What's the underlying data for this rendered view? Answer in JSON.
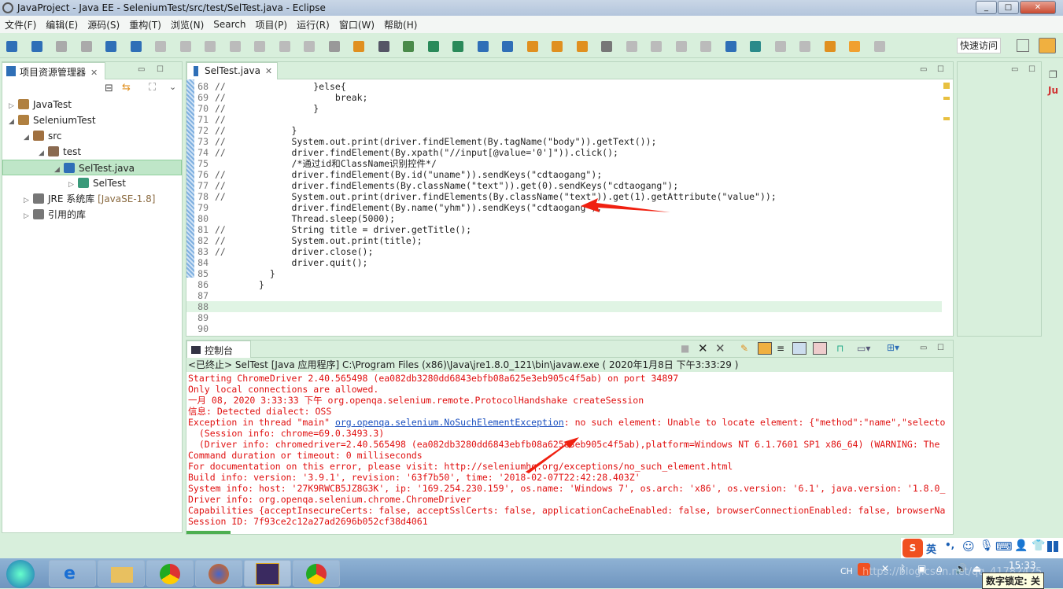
{
  "window": {
    "title": "JavaProject  -  Java EE  -  SeleniumTest/src/test/SelTest.java  -  Eclipse"
  },
  "menu": [
    "文件(F)",
    "编辑(E)",
    "源码(S)",
    "重构(T)",
    "浏览(N)",
    "Search",
    "项目(P)",
    "运行(R)",
    "窗口(W)",
    "帮助(H)"
  ],
  "toolbar": {
    "quick_access": "快速访问"
  },
  "explorer": {
    "title": "项目资源管理器",
    "items": [
      {
        "label": "JavaTest",
        "depth": 0,
        "expanded": false
      },
      {
        "label": "SeleniumTest",
        "depth": 0,
        "expanded": true
      },
      {
        "label": "src",
        "depth": 1,
        "expanded": true
      },
      {
        "label": "test",
        "depth": 2,
        "expanded": true
      },
      {
        "label": "SelTest.java",
        "depth": 3,
        "expanded": true,
        "selected": true
      },
      {
        "label": "SelTest",
        "depth": 4,
        "expanded": false
      },
      {
        "label": "JRE 系统库",
        "extra": "[JavaSE-1.8]",
        "depth": 1,
        "expanded": false
      },
      {
        "label": "引用的库",
        "depth": 1,
        "expanded": false
      }
    ]
  },
  "editor": {
    "tab": "SelTest.java",
    "current_line": 88,
    "lines": [
      {
        "n": "68",
        "c": "//",
        "t": "          }else{"
      },
      {
        "n": "69",
        "c": "//",
        "t": "              break;"
      },
      {
        "n": "70",
        "c": "//",
        "t": "          }"
      },
      {
        "n": "71",
        "c": "//",
        "t": ""
      },
      {
        "n": "72",
        "c": "//",
        "t": "      }"
      },
      {
        "n": "73",
        "c": "//",
        "t": "      System.out.print(driver.findElement(By.tagName(\"body\")).getText());"
      },
      {
        "n": "74",
        "c": "//",
        "t": "      driver.findElement(By.xpath(\"//input[@value='0']\")).click();"
      },
      {
        "n": "75",
        "c": "",
        "t": "      /*通过id和ClassName识别控件*/"
      },
      {
        "n": "76",
        "c": "//",
        "t": "      driver.findElement(By.id(\"uname\")).sendKeys(\"cdtaogang\");"
      },
      {
        "n": "77",
        "c": "//",
        "t": "      driver.findElements(By.className(\"text\")).get(0).sendKeys(\"cdtaogang\");"
      },
      {
        "n": "78",
        "c": "//",
        "t": "      System.out.print(driver.findElements(By.className(\"text\")).get(1).getAttribute(\"value\"));"
      },
      {
        "n": "79",
        "c": "",
        "t": "      driver.findElement(By.name(\"yhm\")).sendKeys(\"cdtaogang\");"
      },
      {
        "n": "80",
        "c": "",
        "t": "      Thread.sleep(5000);"
      },
      {
        "n": "81",
        "c": "//",
        "t": "      String title = driver.getTitle();"
      },
      {
        "n": "82",
        "c": "//",
        "t": "      System.out.print(title);"
      },
      {
        "n": "83",
        "c": "//",
        "t": "      driver.close();"
      },
      {
        "n": "84",
        "c": "",
        "t": "      driver.quit();"
      },
      {
        "n": "85",
        "c": "",
        "t": "  }"
      },
      {
        "n": "86",
        "c": "",
        "t": "}"
      },
      {
        "n": "87",
        "c": "",
        "t": ""
      },
      {
        "n": "88",
        "c": "",
        "t": ""
      },
      {
        "n": "89",
        "c": "",
        "t": ""
      },
      {
        "n": "90",
        "c": "",
        "t": ""
      }
    ]
  },
  "console": {
    "tab": "控制台",
    "header": "<已终止> SelTest [Java 应用程序] C:\\Program Files (x86)\\Java\\jre1.8.0_121\\bin\\javaw.exe ( 2020年1月8日 下午3:33:29 )",
    "lines": [
      "Starting ChromeDriver 2.40.565498 (ea082db3280dd6843ebfb08a625e3eb905c4f5ab) on port 34897",
      "Only local connections are allowed.",
      "一月 08, 2020 3:33:33 下午 org.openqa.selenium.remote.ProtocolHandshake createSession",
      "信息: Detected dialect: OSS",
      "",
      "  (Session info: chrome=69.0.3493.3)",
      "  (Driver info: chromedriver=2.40.565498 (ea082db3280dd6843ebfb08a625e3eb905c4f5ab),platform=Windows NT 6.1.7601 SP1 x86_64) (WARNING: The",
      "Command duration or timeout: 0 milliseconds",
      "For documentation on this error, please visit: http://seleniumhq.org/exceptions/no_such_element.html",
      "Build info: version: '3.9.1', revision: '63f7b50', time: '2018-02-07T22:42:28.403Z'",
      "System info: host: '27K9RWCB5JZ8G3K', ip: '169.254.230.159', os.name: 'Windows 7', os.arch: 'x86', os.version: '6.1', java.version: '1.8.0_",
      "Driver info: org.openqa.selenium.chrome.ChromeDriver",
      "Capabilities {acceptInsecureCerts: false, acceptSslCerts: false, applicationCacheEnabled: false, browserConnectionEnabled: false, browserNa",
      "Session ID: 7f93ce2c12a27ad2696b052cf38d4061"
    ],
    "exception_prefix": "Exception in thread \"main\" ",
    "exception_link": "org.openqa.selenium.NoSuchElementException",
    "exception_suffix": ": no such element: Unable to locate element: {\"method\":\"name\",\"selecto"
  },
  "ime": {
    "mode": "英"
  },
  "tray": {
    "lang": "CH",
    "time": "15:33",
    "tooltip": "数字锁定: 关",
    "watermark": "https://blog.csdn.net/qq_41782425"
  },
  "colors": {
    "accent_green": "#d8efdc",
    "error_red": "#e01010",
    "annotation_arrow": "#f02010"
  }
}
